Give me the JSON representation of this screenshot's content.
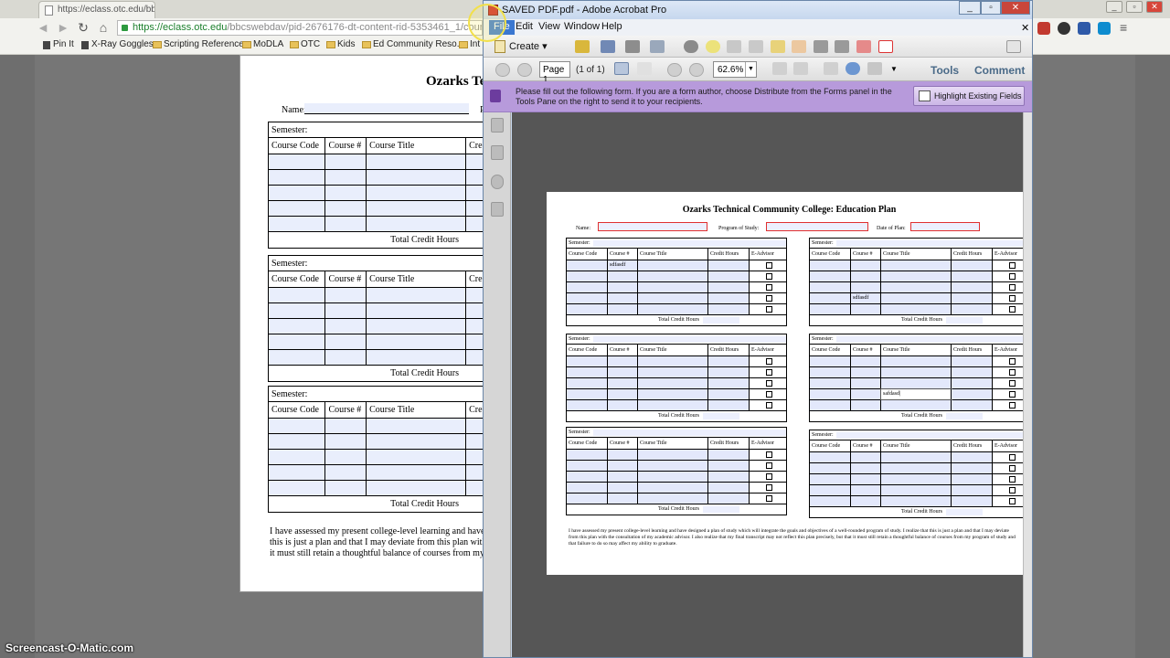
{
  "browser": {
    "tab_title": "https://eclass.otc.edu/bb",
    "url_host": "https://eclass.otc.edu",
    "url_path": "/bbcswebdav/pid-2676176-dt-content-rid-5353461_1/cours",
    "bookmarks": [
      "Pin It",
      "X-Ray Goggles",
      "Scripting Reference",
      "MoDLA",
      "OTC",
      "Kids",
      "Ed Community Reso...",
      "Int"
    ]
  },
  "web_pdf": {
    "title": "Ozarks Te",
    "name_label": "Name:",
    "p_label": "P",
    "semester_label": "Semester:",
    "headers": [
      "Course Code",
      "Course #",
      "Course Title",
      "Cre"
    ],
    "total_label": "Total Credit Hours",
    "para_lines": [
      "I have assessed my present college-level learning and have de",
      "this is just a plan and that I may deviate from this plan with th",
      "it must still retain a thoughtful balance of courses from my pr"
    ]
  },
  "acrobat": {
    "window_title": "SAVED PDF.pdf - Adobe Acrobat Pro",
    "menu": [
      "File",
      "Edit",
      "View",
      "Window",
      "Help"
    ],
    "create_label": "Create",
    "page_value": "Page 1",
    "page_count": "(1 of 1)",
    "zoom": "62.6%",
    "tools_label": "Tools",
    "comment_label": "Comment",
    "form_message": "Please fill out the following form. If you are a form author, choose Distribute from the Forms panel in the Tools Pane on the right to send it to your recipients.",
    "highlight_button": "Highlight Existing Fields"
  },
  "pdf": {
    "title": "Ozarks Technical Community College: Education Plan",
    "name_label": "Name:",
    "program_label": "Program of Study:",
    "date_label": "Date of Plan:",
    "semester_label": "Semester:",
    "headers": [
      "Course Code",
      "Course #",
      "Course Title",
      "Credit Hours",
      "E-Advisor"
    ],
    "total_label": "Total Credit Hours",
    "entry_1": "sdfasdf",
    "entry_2": "sdfasdf",
    "entry_3": "safdasd|",
    "paragraph": "I have assessed my present college-level learning and have designed a plan of study which will integrate the goals and objectives of a well-rounded program of study. I realize that this is just a plan and that I may deviate from this plan with the consultation of my academic advisor. I also realize that my final transcript may not reflect this plan precisely, but that it must still retain a thoughtful balance of courses from my program of study and that failure to do so may affect my ability to graduate."
  },
  "watermark": "Screencast-O-Matic.com",
  "colors": {
    "form_bar": "#b79adb",
    "field_highlight": "#eceffd",
    "menu_highlight": "#3a77d0"
  }
}
